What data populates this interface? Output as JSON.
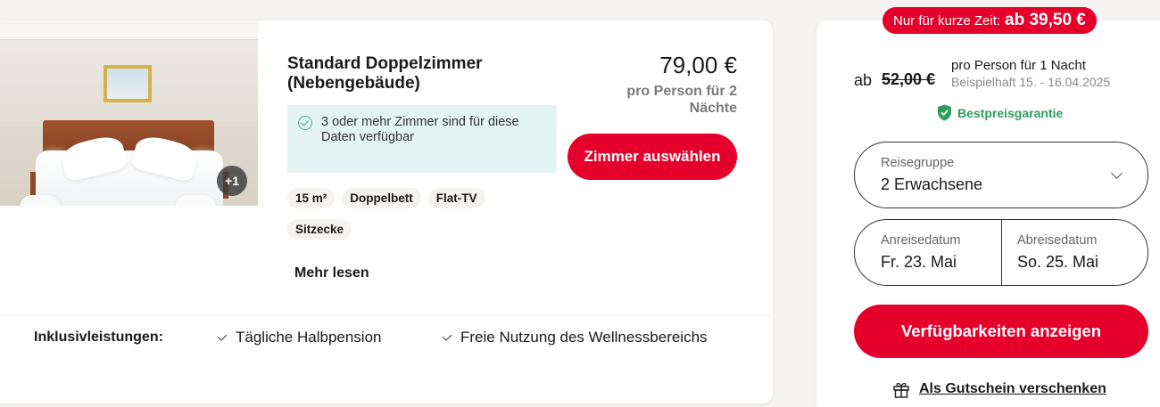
{
  "room": {
    "title": "Standard Doppelzimmer (Nebengebäude)",
    "image_more_count": "+1",
    "availability_note": "3 oder mehr Zimmer sind für diese Daten verfügbar",
    "price": "79,00 €",
    "price_sub": "pro Person für 2 Nächte",
    "select_button": "Zimmer auswählen",
    "features": [
      "15 m²",
      "Doppelbett",
      "Flat-TV",
      "Sitzecke"
    ],
    "read_more": "Mehr lesen"
  },
  "inclusive": {
    "label": "Inklusivleistungen:",
    "items": [
      "Tägliche Halbpension",
      "Freie Nutzung des Wellnessbereichs"
    ]
  },
  "booking": {
    "promo_text": "Nur für kurze Zeit:",
    "promo_price": "ab 39,50 €",
    "ab_label": "ab",
    "old_price": "52,00 €",
    "per_person": "pro Person für 1 Nacht",
    "example_date": "Beispielhaft 15. - 16.04.2025",
    "bestprice": "Bestpreisgarantie",
    "group_label": "Reisegruppe",
    "group_value": "2 Erwachsene",
    "arrival_label": "Anreisedatum",
    "arrival_value": "Fr. 23. Mai",
    "departure_label": "Abreisedatum",
    "departure_value": "So. 25. Mai",
    "availability_button": "Verfügbarkeiten anzeigen",
    "voucher": "Als Gutschein verschenken"
  },
  "colors": {
    "brand_red": "#e5002b",
    "success_green": "#2f9c5b",
    "availability_bg": "#e3f4f2"
  },
  "icons": [
    "check-circle-icon",
    "check-icon",
    "shield-check-icon",
    "chevron-down-icon",
    "gift-icon"
  ]
}
